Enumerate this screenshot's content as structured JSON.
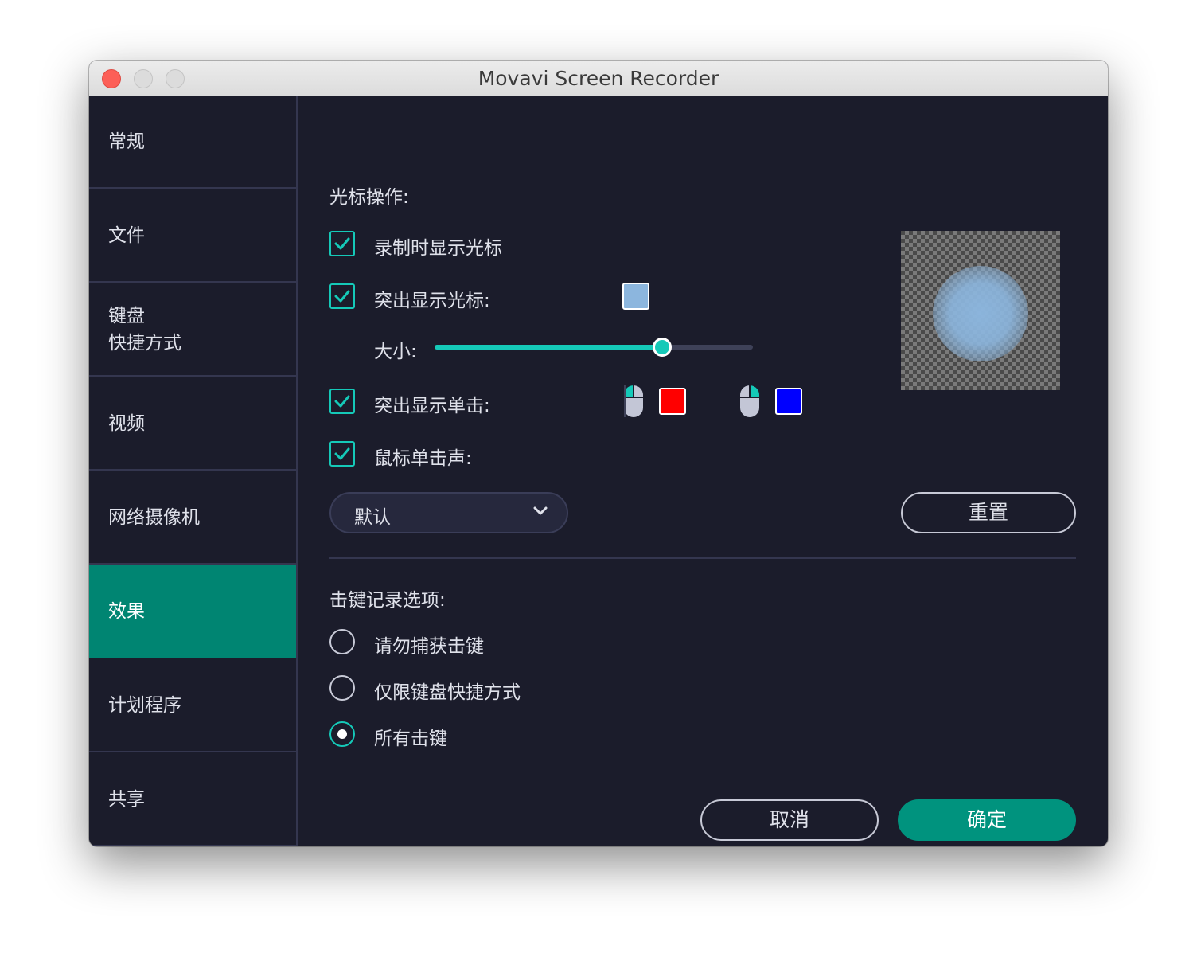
{
  "window": {
    "title": "Movavi Screen Recorder"
  },
  "sidebar": {
    "items": [
      {
        "label": "常规"
      },
      {
        "label": "文件"
      },
      {
        "label": "键盘\n快捷方式"
      },
      {
        "label": "视频"
      },
      {
        "label": "网络摄像机"
      },
      {
        "label": "效果",
        "active": true
      },
      {
        "label": "计划程序"
      },
      {
        "label": "共享"
      }
    ]
  },
  "cursor_section": {
    "heading": "光标操作:",
    "show_cursor": {
      "label": "录制时显示光标",
      "checked": true
    },
    "highlight_cursor": {
      "label": "突出显示光标:",
      "checked": true,
      "color": "#8cb6de"
    },
    "size": {
      "label": "大小:",
      "value_fraction": 0.715
    },
    "highlight_clicks": {
      "label": "突出显示单击:",
      "checked": true,
      "left_click_color": "#ff0000",
      "right_click_color": "#0000ff"
    },
    "click_sound": {
      "label": "鼠标单击声:",
      "checked": true
    },
    "sound_dropdown": {
      "value": "默认"
    },
    "reset_button": "重置"
  },
  "keystroke_section": {
    "heading": "击键记录选项:",
    "options": [
      {
        "label": "请勿捕获击键",
        "selected": false
      },
      {
        "label": "仅限键盘快捷方式",
        "selected": false
      },
      {
        "label": "所有击键",
        "selected": true
      }
    ]
  },
  "footer": {
    "cancel_label": "取消",
    "ok_label": "确定"
  },
  "colors": {
    "accent": "#15c9b8",
    "active_nav": "#008572",
    "primary_button": "#00937e",
    "background": "#1b1c2b"
  }
}
